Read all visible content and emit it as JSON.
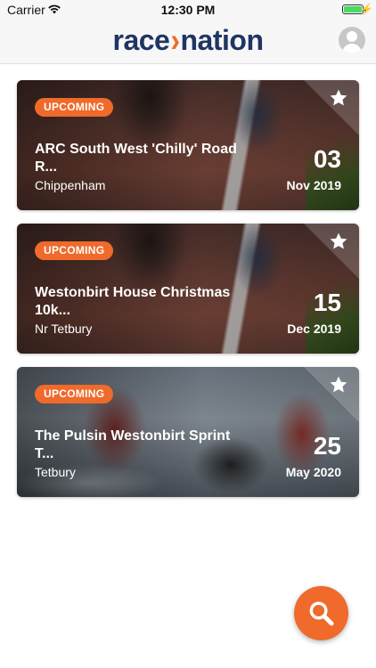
{
  "status_bar": {
    "carrier": "Carrier",
    "time": "12:30 PM"
  },
  "header": {
    "logo_left": "race",
    "logo_right": "nation",
    "profile_icon": "user-avatar-icon"
  },
  "events": [
    {
      "badge": "UPCOMING",
      "title": "ARC South West 'Chilly' Road R...",
      "location": "Chippenham",
      "day": "03",
      "month_year": "Nov 2019"
    },
    {
      "badge": "UPCOMING",
      "title": "Westonbirt House Christmas 10k...",
      "location": "Nr Tetbury",
      "day": "15",
      "month_year": "Dec 2019"
    },
    {
      "badge": "UPCOMING",
      "title": "The Pulsin Westonbirt Sprint T...",
      "location": "Tetbury",
      "day": "25",
      "month_year": "May 2020"
    }
  ],
  "fab": {
    "icon": "search-icon"
  },
  "colors": {
    "accent": "#ef6a2b",
    "brand_navy": "#1f3563"
  }
}
